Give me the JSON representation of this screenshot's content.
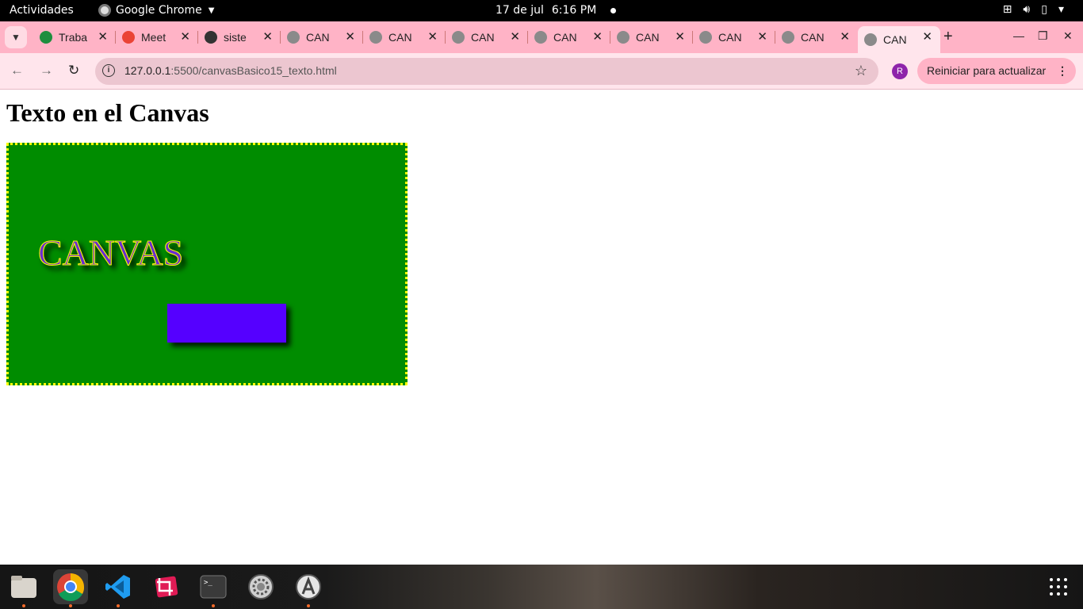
{
  "topbar": {
    "activities": "Actividades",
    "app_name": "Google Chrome",
    "date": "17 de jul",
    "time": "6:16 PM"
  },
  "tabs": [
    {
      "label": "Traba",
      "favicon_color": "#1e8e3e"
    },
    {
      "label": "Meet",
      "favicon_color": "#ea4335"
    },
    {
      "label": "siste",
      "favicon_color": "#333333"
    },
    {
      "label": "CAN",
      "favicon_color": "#8a8a8a"
    },
    {
      "label": "CAN",
      "favicon_color": "#8a8a8a"
    },
    {
      "label": "CAN",
      "favicon_color": "#8a8a8a"
    },
    {
      "label": "CAN",
      "favicon_color": "#8a8a8a"
    },
    {
      "label": "CAN",
      "favicon_color": "#8a8a8a"
    },
    {
      "label": "CAN",
      "favicon_color": "#8a8a8a"
    },
    {
      "label": "CAN",
      "favicon_color": "#8a8a8a"
    },
    {
      "label": "CAN",
      "favicon_color": "#8a8a8a",
      "active": true
    }
  ],
  "address": {
    "host": "127.0.0.1",
    "path": ":5500/canvasBasico15_texto.html"
  },
  "profile_initial": "R",
  "update_button": "Reiniciar para actualizar",
  "page": {
    "heading": "Texto en el Canvas",
    "canvas_text": "CANVAS",
    "canvas_bg": "#008c00",
    "canvas_border": "#ffff00",
    "rect_color": "#5500ff",
    "text_fill": "#6a2fd0",
    "text_stroke": "#ffff00"
  },
  "dock": {
    "items": [
      "files-icon",
      "chrome-icon",
      "vscode-icon",
      "screenshot-icon",
      "terminal-icon",
      "settings-icon",
      "software-icon"
    ]
  }
}
